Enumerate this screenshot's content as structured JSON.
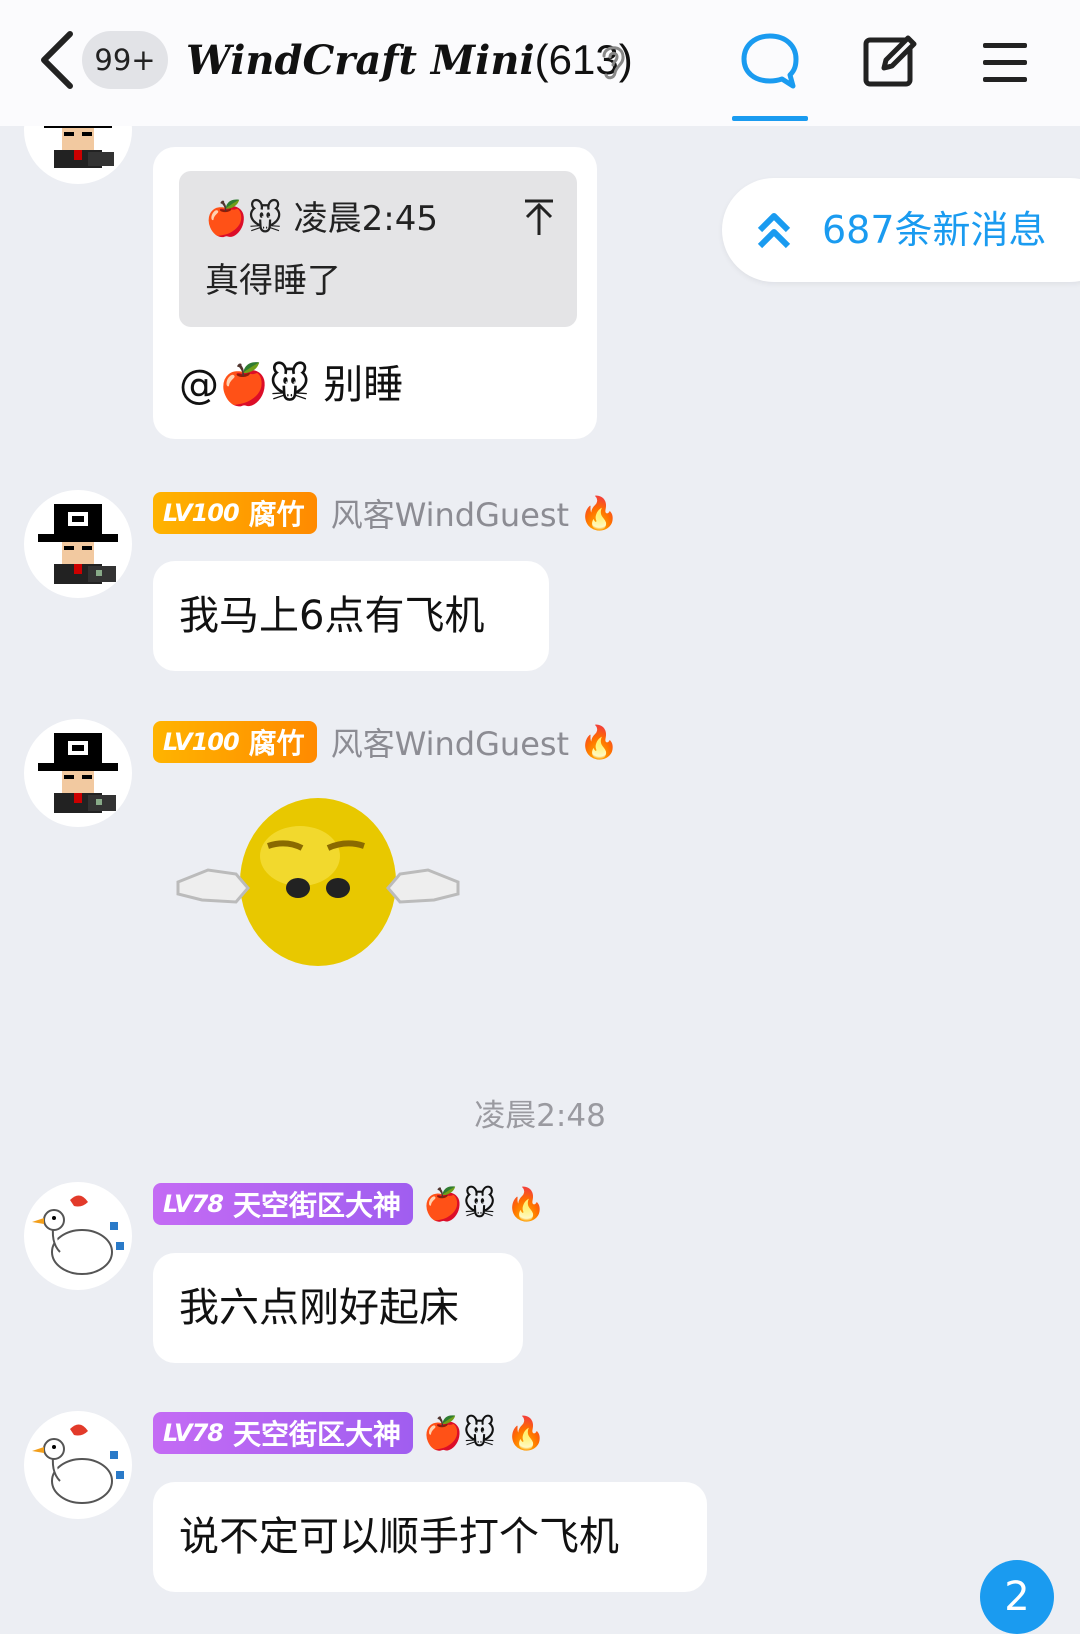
{
  "header": {
    "unread_count": "99+",
    "group_name": "WindCraft Mini",
    "member_count": "(613)",
    "accent_color": "#1a9bf0"
  },
  "new_messages": {
    "label": "687条新消息"
  },
  "messages": [
    {
      "quote_sender_emoji": "🍎🐭",
      "quote_time": "凌晨2:45",
      "quote_text": "真得睡了",
      "text": "@🍎🐭 别睡"
    },
    {
      "badge_level": "LV100",
      "badge_title": "腐竹",
      "nickname": "风客WindGuest",
      "flame": "🔥",
      "text": "我马上6点有飞机"
    },
    {
      "badge_level": "LV100",
      "badge_title": "腐竹",
      "nickname": "风客WindGuest",
      "flame": "🔥",
      "sticker": "yellow-face-sticker"
    },
    {
      "badge_level": "LV78",
      "badge_title": "天空街区大神",
      "nickname": "🍎🐭",
      "flame": "🔥",
      "text": "我六点刚好起床"
    },
    {
      "badge_level": "LV78",
      "badge_title": "天空街区大神",
      "nickname": "🍎🐭",
      "flame": "🔥",
      "text": "说不定可以顺手打个飞机"
    }
  ],
  "time_separator": "凌晨2:48",
  "floating_badge": "2"
}
